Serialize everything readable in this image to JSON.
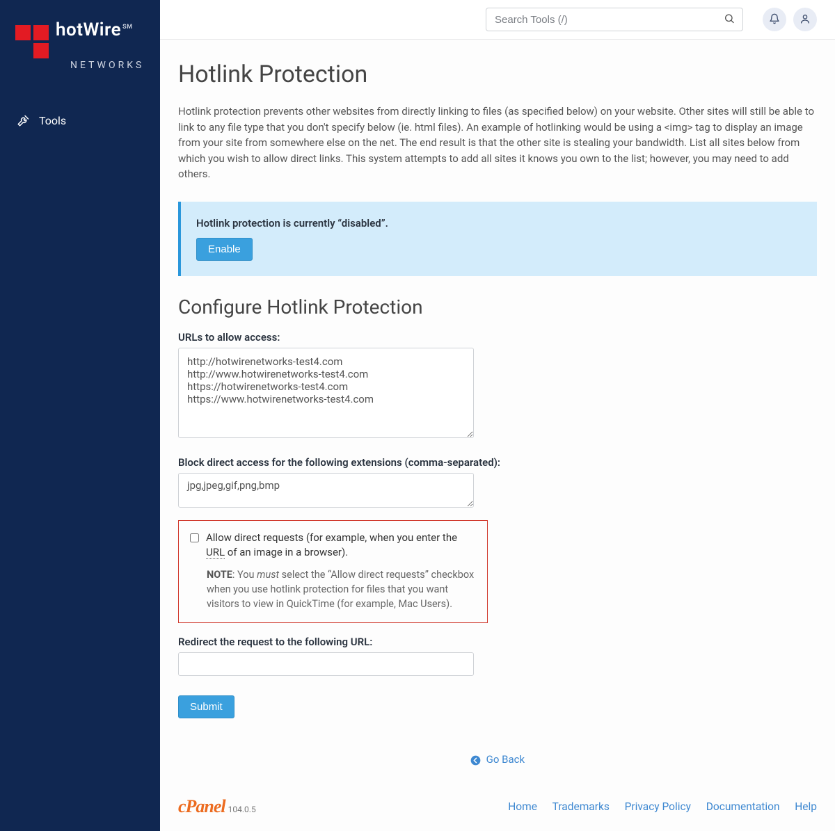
{
  "brand": {
    "line1": "hotWire",
    "sm": "SM",
    "line2": "NETWORKS"
  },
  "sidebar": {
    "tools_label": "Tools"
  },
  "topbar": {
    "search_placeholder": "Search Tools (/)"
  },
  "page": {
    "title": "Hotlink Protection",
    "intro": "Hotlink protection prevents other websites from directly linking to files (as specified below) on your website. Other sites will still be able to link to any file type that you don't specify below (ie. html files). An example of hotlinking would be using a <img> tag to display an image from your site from somewhere else on the net. The end result is that the other site is stealing your bandwidth. List all sites below from which you wish to allow direct links. This system attempts to add all sites it knows you own to the list; however, you may need to add others."
  },
  "status": {
    "text": "Hotlink protection is currently “disabled”.",
    "enable_label": "Enable"
  },
  "configure": {
    "heading": "Configure Hotlink Protection",
    "urls_label": "URLs to allow access:",
    "urls_value": "http://hotwirenetworks-test4.com\nhttp://www.hotwirenetworks-test4.com\nhttps://hotwirenetworks-test4.com\nhttps://www.hotwirenetworks-test4.com",
    "block_label": "Block direct access for the following extensions (comma-separated):",
    "block_value": "jpg,jpeg,gif,png,bmp",
    "allow_direct_pre": "Allow direct requests (for example, when you enter the ",
    "allow_direct_url": "URL",
    "allow_direct_post": " of an image in a browser).",
    "note_label": "NOTE",
    "note_pre": ": You ",
    "note_em": "must",
    "note_post": " select the “Allow direct requests” checkbox when you use hotlink protection for files that you want visitors to view in QuickTime (for example, Mac Users).",
    "redirect_label": "Redirect the request to the following URL:",
    "redirect_value": "",
    "submit_label": "Submit"
  },
  "goback": {
    "label": "Go Back"
  },
  "footer": {
    "brand": "cPanel",
    "version": "104.0.5",
    "links": {
      "home": "Home",
      "trademarks": "Trademarks",
      "privacy": "Privacy Policy",
      "docs": "Documentation",
      "help": "Help"
    }
  }
}
